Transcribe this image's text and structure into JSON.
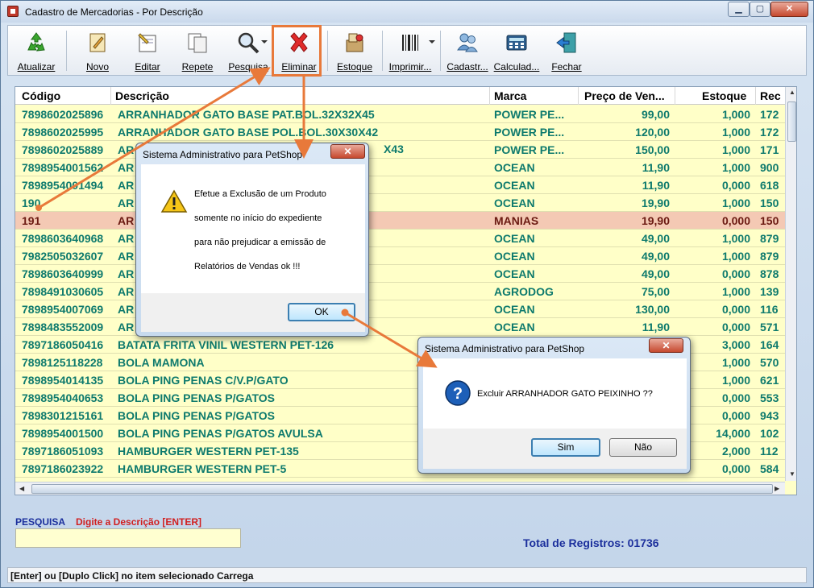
{
  "window": {
    "title": "Cadastro de Mercadorias - Por Descrição",
    "min_icon": "minimize-icon",
    "max_icon": "maximize-icon",
    "close_icon": "close-icon"
  },
  "toolbar": {
    "buttons": [
      {
        "label": "Atualizar",
        "icon": "recycle-icon"
      },
      {
        "label": "Novo",
        "icon": "new-document-icon"
      },
      {
        "label": "Editar",
        "icon": "edit-icon"
      },
      {
        "label": "Repete",
        "icon": "copy-icon"
      },
      {
        "label": "Pesquisa",
        "icon": "search-icon"
      },
      {
        "label": "Eliminar",
        "icon": "delete-x-icon"
      },
      {
        "label": "Estoque",
        "icon": "stock-icon"
      },
      {
        "label": "Imprimir...",
        "icon": "barcode-icon"
      },
      {
        "label": "Cadastr...",
        "icon": "users-icon"
      },
      {
        "label": "Calculad...",
        "icon": "calculator-icon"
      },
      {
        "label": "Fechar",
        "icon": "exit-door-icon"
      }
    ]
  },
  "grid": {
    "headers": [
      "Código",
      "Descrição",
      "Marca",
      "Preço de Ven...",
      "Estoque",
      "Rec"
    ],
    "rows": [
      [
        "7898602025896",
        "ARRANHADOR GATO BASE PAT.BOL.32X32X45",
        "POWER PE...",
        "99,00",
        "1,000",
        "172"
      ],
      [
        "7898602025995",
        "ARRANHADOR GATO BASE POL.BOL.30X30X42",
        "POWER PE...",
        "120,00",
        "1,000",
        "172"
      ],
      [
        "7898602025889",
        "AR",
        "POWER PE...",
        "150,00",
        "1,000",
        "171"
      ],
      [
        "7898954001562",
        "AR",
        "OCEAN",
        "11,90",
        "1,000",
        "900"
      ],
      [
        "7898954001494",
        "AR",
        "OCEAN",
        "11,90",
        "0,000",
        "618"
      ],
      [
        "190",
        "AR",
        "OCEAN",
        "19,90",
        "1,000",
        "150"
      ],
      [
        "191",
        "AR",
        "MANIAS",
        "19,90",
        "0,000",
        "150"
      ],
      [
        "7898603640968",
        "AR",
        "OCEAN",
        "49,00",
        "1,000",
        "879"
      ],
      [
        "7982505032607",
        "AR",
        "OCEAN",
        "49,00",
        "1,000",
        "879"
      ],
      [
        "7898603640999",
        "AR",
        "OCEAN",
        "49,00",
        "0,000",
        "878"
      ],
      [
        "7898491030605",
        "AR",
        "AGRODOG",
        "75,00",
        "1,000",
        "139"
      ],
      [
        "7898954007069",
        "AR",
        "OCEAN",
        "130,00",
        "0,000",
        "116"
      ],
      [
        "7898483552009",
        "AR",
        "OCEAN",
        "11,90",
        "0,000",
        "571"
      ],
      [
        "7897186050416",
        "BATATA FRITA VINIL WESTERN PET-126",
        "",
        "",
        "3,000",
        "164"
      ],
      [
        "7898125118228",
        "BOLA MAMONA",
        "",
        "",
        "1,000",
        "570"
      ],
      [
        "7898954014135",
        "BOLA PING PENAS C/V.P/GATO",
        "",
        "",
        "1,000",
        "621"
      ],
      [
        "7898954040653",
        "BOLA PING PENAS P/GATOS",
        "",
        "",
        "0,000",
        "553"
      ],
      [
        "7898301215161",
        "BOLA PING PENAS P/GATOS",
        "",
        "",
        "0,000",
        "943"
      ],
      [
        "7898954001500",
        "BOLA PING PENAS P/GATOS AVULSA",
        "",
        "",
        "14,000",
        "102"
      ],
      [
        "7897186051093",
        "HAMBURGER WESTERN PET-135",
        "",
        "",
        "2,000",
        "112"
      ],
      [
        "7897186023922",
        "HAMBURGER WESTERN PET-5",
        "",
        "",
        "0,000",
        "584"
      ]
    ],
    "description_overflow": "X43"
  },
  "search": {
    "label": "PESQUISA",
    "hint": "Digite a Descrição [ENTER]",
    "value": ""
  },
  "total": "Total de Registros: 01736",
  "status": "[Enter] ou [Duplo Click] no item selecionado Carrega",
  "dialog1": {
    "title": "Sistema Administrativo para PetShop",
    "icon": "warning-icon",
    "lines": [
      "Efetue a Exclusão de um Produto",
      "somente no início do expediente",
      "para não prejudicar a emissão de",
      "Relatórios de Vendas ok !!!"
    ],
    "ok_label": "OK"
  },
  "dialog2": {
    "title": "Sistema Administrativo para PetShop",
    "icon": "question-icon",
    "message": "Excluir ARRANHADOR GATO PEIXINHO ??",
    "yes_label": "Sim",
    "no_label": "Não"
  },
  "colors": {
    "accent_arrow": "#e8793a",
    "grid_text": "#0e7a6d",
    "grid_bg": "#ffffc8",
    "selected_row": "#f4c9b4"
  }
}
